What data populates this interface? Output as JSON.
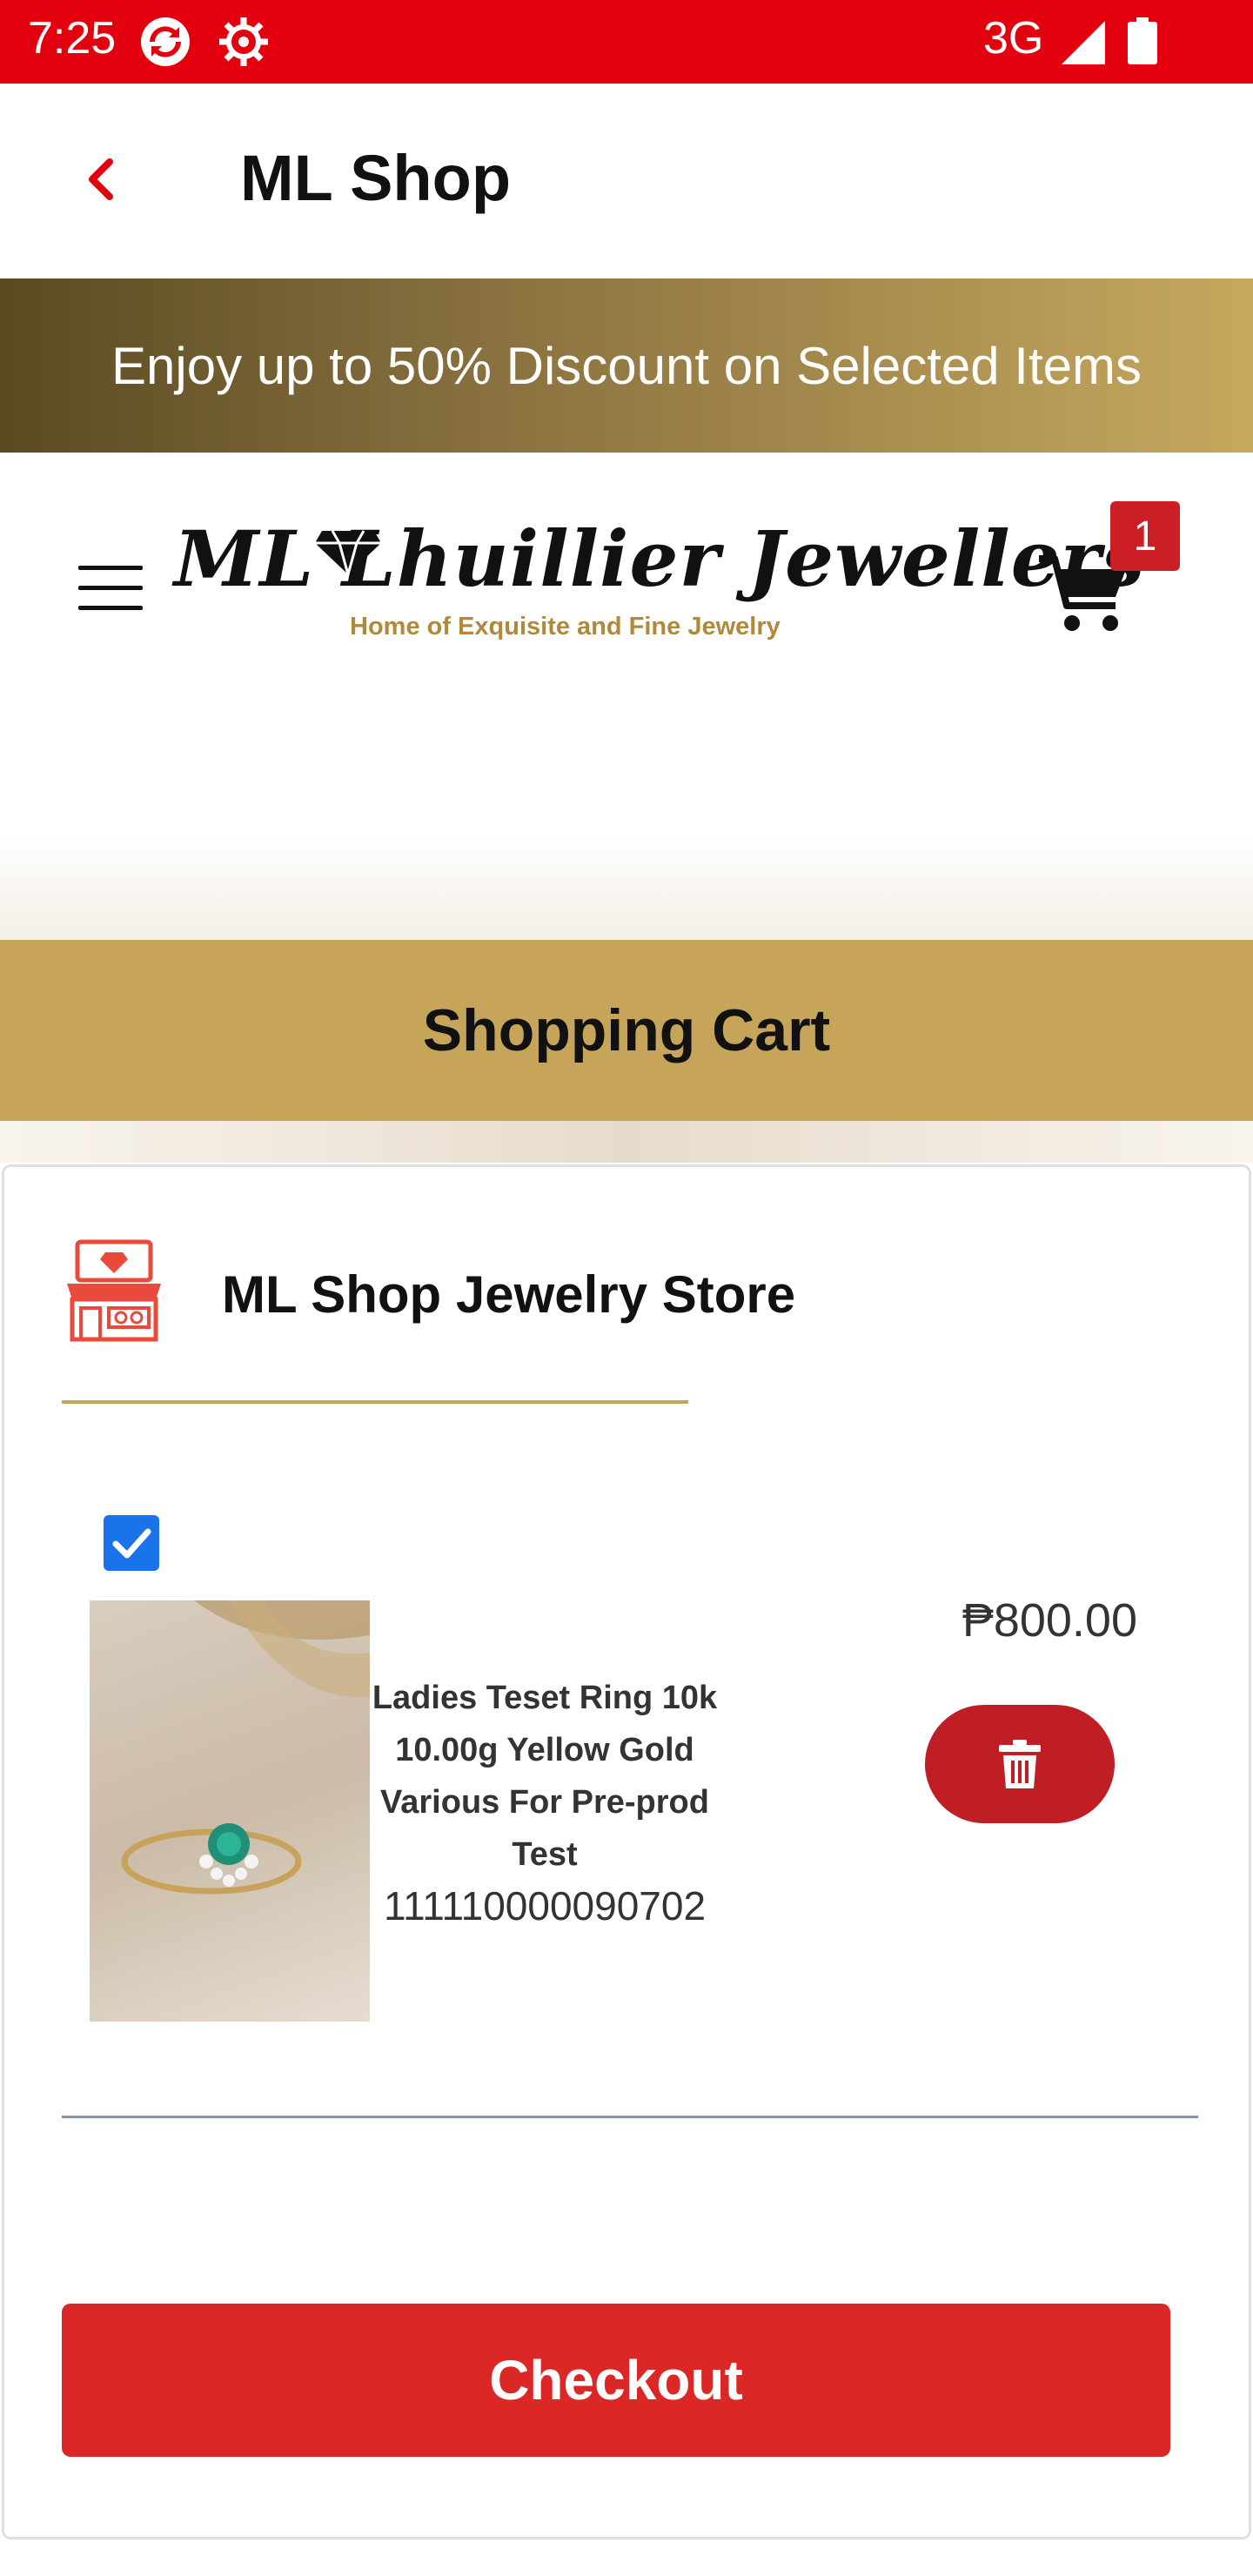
{
  "status_bar": {
    "time": "7:25",
    "network": "3G",
    "icons": [
      "sync-icon",
      "gear-icon",
      "signal-icon",
      "battery-icon"
    ]
  },
  "app_bar": {
    "title": "ML Shop",
    "back_icon": "chevron-left-icon"
  },
  "promo": {
    "text": "Enjoy up to 50% Discount on Selected Items"
  },
  "header": {
    "logo_text": "ML Lhuillier Jewellers",
    "logo_tagline": "Home of Exquisite and Fine Jewelry",
    "cart_count": "1"
  },
  "cart": {
    "heading": "Shopping Cart",
    "store_name": "ML Shop Jewelry Store",
    "items": [
      {
        "checked": true,
        "name": "Ladies Teset Ring 10k 10.00g Yellow Gold Various For Pre-prod Test",
        "sku": "111110000090702",
        "price": "₱800.00"
      }
    ],
    "checkout_label": "Checkout"
  },
  "colors": {
    "status_red": "#e3000f",
    "accent_gold": "#c6a55a",
    "button_red": "#dc2727",
    "delete_red": "#bf1e24",
    "checkbox_blue": "#1a73e8"
  }
}
